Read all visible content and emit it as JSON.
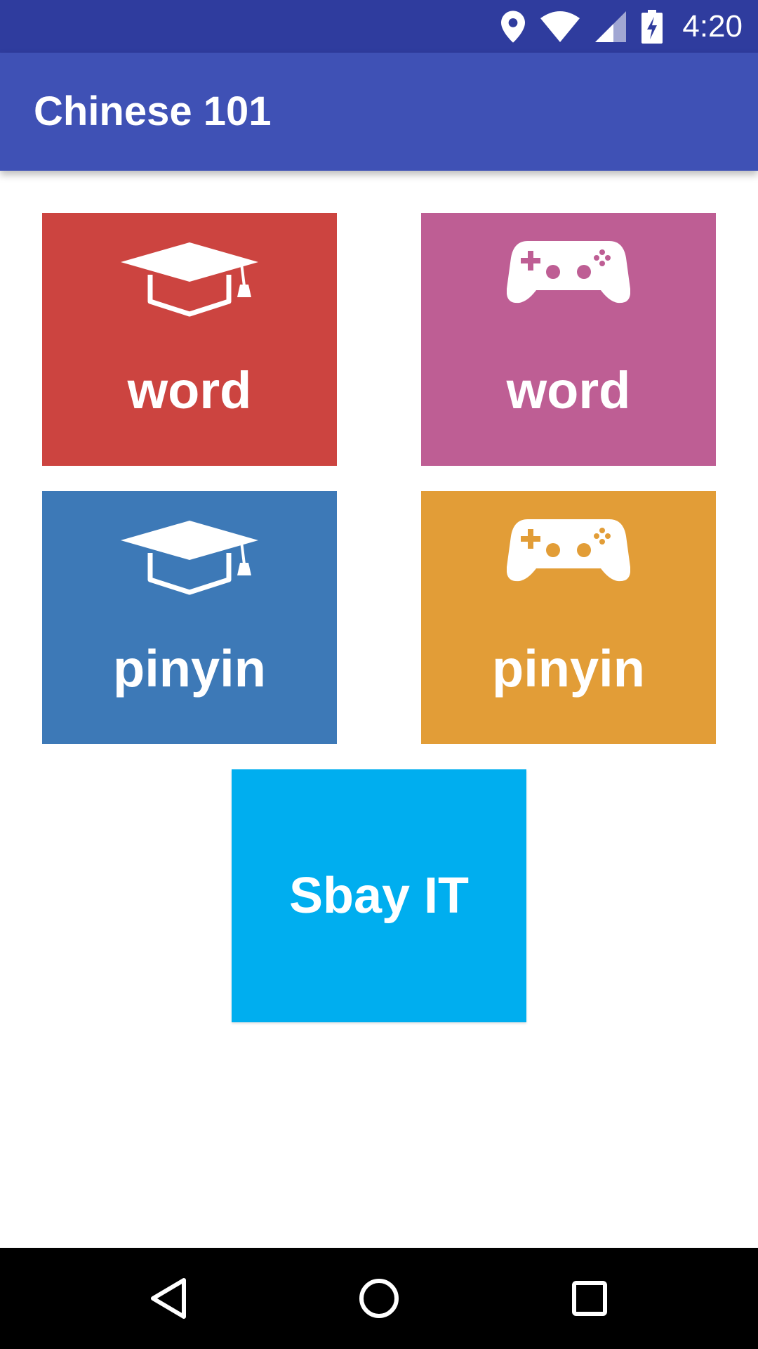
{
  "status_bar": {
    "time": "4:20",
    "icons": [
      "location-icon",
      "wifi-icon",
      "signal-icon",
      "battery-charging-icon"
    ]
  },
  "app_bar": {
    "title": "Chinese 101"
  },
  "tiles": [
    {
      "label": "word",
      "icon": "graduation-cap-icon",
      "color": "#cc4440"
    },
    {
      "label": "word",
      "icon": "gamepad-icon",
      "color": "#be5e94"
    },
    {
      "label": "pinyin",
      "icon": "graduation-cap-icon",
      "color": "#3d79b7"
    },
    {
      "label": "pinyin",
      "icon": "gamepad-icon",
      "color": "#e29d37"
    },
    {
      "label": "Sbay IT",
      "color": "#00aeef"
    }
  ],
  "colors": {
    "status_bar": "#2f3c9e",
    "app_bar": "#3f51b5",
    "nav_bar": "#000000"
  },
  "nav_bar": {
    "buttons": [
      "back-icon",
      "home-icon",
      "recents-icon"
    ]
  }
}
